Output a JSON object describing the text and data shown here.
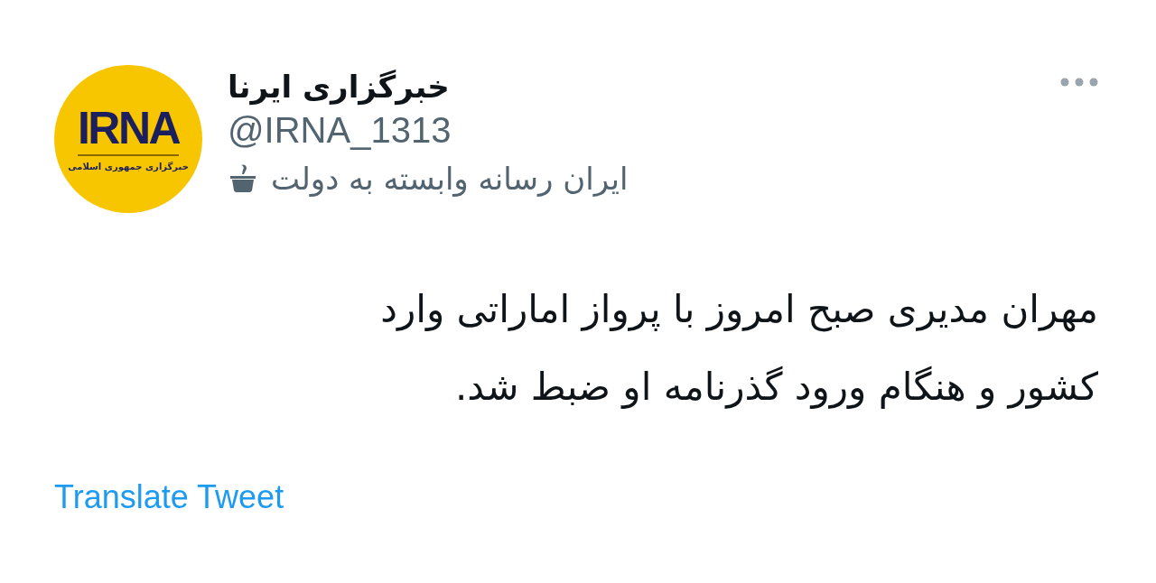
{
  "author": {
    "avatar": {
      "logo_text": "IRNA",
      "logo_subtitle": "خبرگزاری جمهوری اسلامی"
    },
    "name": "خبرگزاری ایرنا",
    "handle": "@IRNA_1313",
    "label": "ایران رسانه وابسته به دولت"
  },
  "tweet": {
    "lines": [
      "مهران مدیری صبح امروز با پرواز اماراتی وارد",
      "کشور و هنگام ورود گذرنامه او ضبط شد."
    ]
  },
  "translate_link": "Translate Tweet"
}
